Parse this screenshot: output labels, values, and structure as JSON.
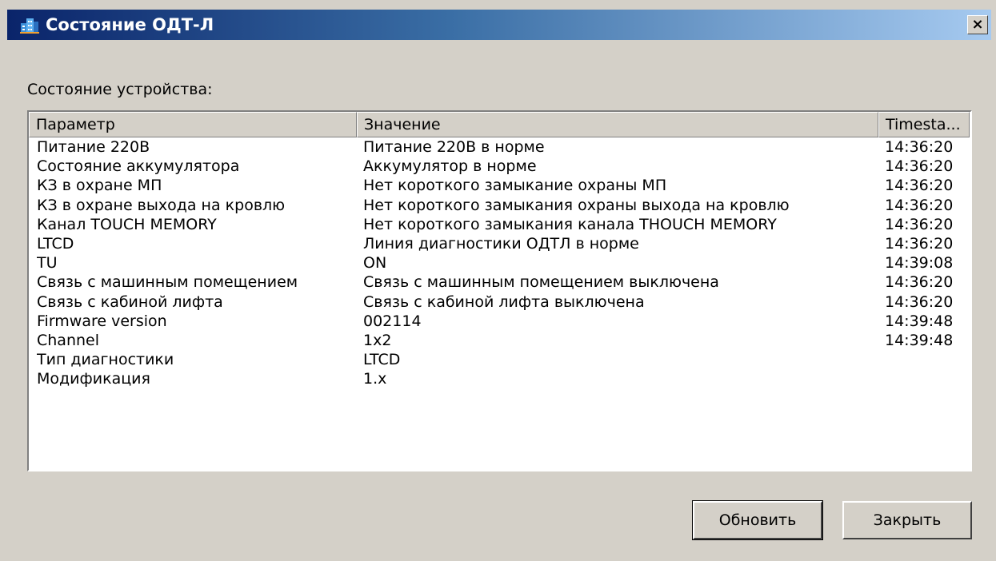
{
  "window": {
    "title": "Состояние ОДТ-Л",
    "close_glyph": "×",
    "icon": "building-icon"
  },
  "group_label": "Состояние устройства:",
  "table": {
    "columns": [
      "Параметр",
      "Значение",
      "Timesta..."
    ],
    "rows": [
      {
        "param": "Питание 220В",
        "value": "Питание 220В в норме",
        "time": "14:36:20"
      },
      {
        "param": "Состояние аккумулятора",
        "value": "Аккумулятор в норме",
        "time": "14:36:20"
      },
      {
        "param": "КЗ в охране МП",
        "value": "Нет короткого замыкание охраны МП",
        "time": "14:36:20"
      },
      {
        "param": "КЗ в охране выхода на кровлю",
        "value": "Нет короткого замыкания охраны выхода на кровлю",
        "time": "14:36:20"
      },
      {
        "param": "Канал TOUCH MEMORY",
        "value": "Нет короткого замыкания канала THOUCH MEMORY",
        "time": "14:36:20"
      },
      {
        "param": "LTCD",
        "value": "Линия диагностики ОДТЛ в норме",
        "time": "14:36:20"
      },
      {
        "param": "TU",
        "value": "ON",
        "time": "14:39:08"
      },
      {
        "param": "Связь с машинным помещением",
        "value": "Связь с машинным помещением выключена",
        "time": "14:36:20"
      },
      {
        "param": "Связь с кабиной лифта",
        "value": "Связь с кабиной лифта выключена",
        "time": "14:36:20"
      },
      {
        "param": "Firmware version",
        "value": "002114",
        "time": "14:39:48"
      },
      {
        "param": "Channel",
        "value": "1x2",
        "time": "14:39:48"
      },
      {
        "param": "Тип диагностики",
        "value": "LTCD",
        "time": ""
      },
      {
        "param": "Модификация",
        "value": "1.x",
        "time": ""
      }
    ]
  },
  "buttons": {
    "refresh": "Обновить",
    "close": "Закрыть"
  },
  "colors": {
    "titlebar_start": "#0a246a",
    "titlebar_end": "#a6caf0",
    "face": "#d4d0c8"
  }
}
